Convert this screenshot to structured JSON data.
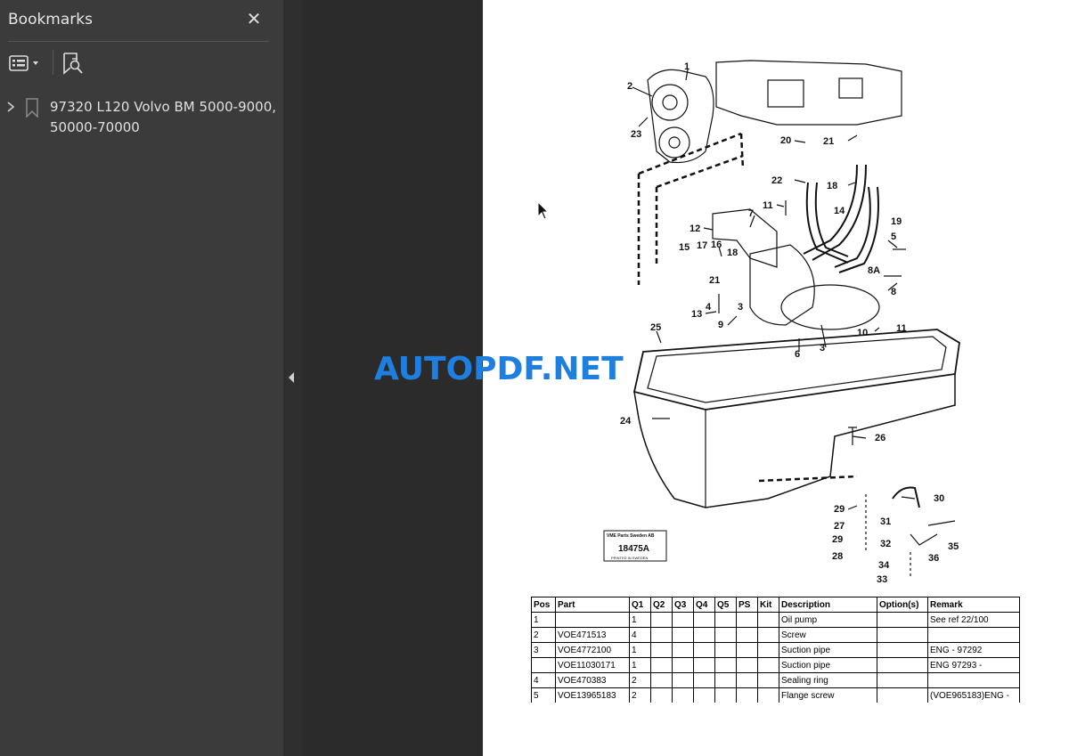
{
  "sidebar": {
    "title": "Bookmarks",
    "close_icon": "close-icon",
    "options_icon": "list-options-icon",
    "find_icon": "find-bookmark-icon",
    "items": [
      {
        "label_line1": "97320 L120 Volvo BM 5000-9000,",
        "label_line2": "50000-70000"
      }
    ]
  },
  "watermark": "AUTOPDF.NET",
  "drawing": {
    "stamp_line1": "VME Parts Sweden AB",
    "stamp_number": "18475A",
    "stamp_line3": "PRINTED IN SWEDEN",
    "callouts": [
      "1",
      "2",
      "23",
      "20",
      "21",
      "22",
      "18",
      "11",
      "14",
      "19",
      "7",
      "12",
      "16",
      "17",
      "15",
      "5",
      "18",
      "21",
      "4",
      "3",
      "13",
      "9",
      "8A",
      "8",
      "25",
      "6",
      "3",
      "10",
      "11",
      "24",
      "26",
      "30",
      "29",
      "31",
      "27",
      "29",
      "35",
      "32",
      "36",
      "28",
      "34",
      "33"
    ]
  },
  "table": {
    "headers": [
      "Pos",
      "Part",
      "Q1",
      "Q2",
      "Q3",
      "Q4",
      "Q5",
      "PS",
      "Kit",
      "Description",
      "Option(s)",
      "Remark"
    ],
    "rows": [
      [
        "1",
        "",
        "1",
        "",
        "",
        "",
        "",
        "",
        "",
        "Oil pump",
        "",
        "See ref 22/100"
      ],
      [
        "2",
        "VOE471513",
        "4",
        "",
        "",
        "",
        "",
        "",
        "",
        "Screw",
        "",
        ""
      ],
      [
        "3",
        "VOE4772100",
        "1",
        "",
        "",
        "",
        "",
        "",
        "",
        "Suction pipe",
        "",
        "ENG - 97292"
      ],
      [
        "",
        "VOE11030171",
        "1",
        "",
        "",
        "",
        "",
        "",
        "",
        "Suction pipe",
        "",
        "ENG 97293 -"
      ],
      [
        "4",
        "VOE470383",
        "2",
        "",
        "",
        "",
        "",
        "",
        "",
        "Sealing ring",
        "",
        ""
      ],
      [
        "5",
        "VOE13965183",
        "2",
        "",
        "",
        "",
        "",
        "",
        "",
        "Flange screw",
        "",
        "(VOE965183)ENG -"
      ]
    ]
  }
}
